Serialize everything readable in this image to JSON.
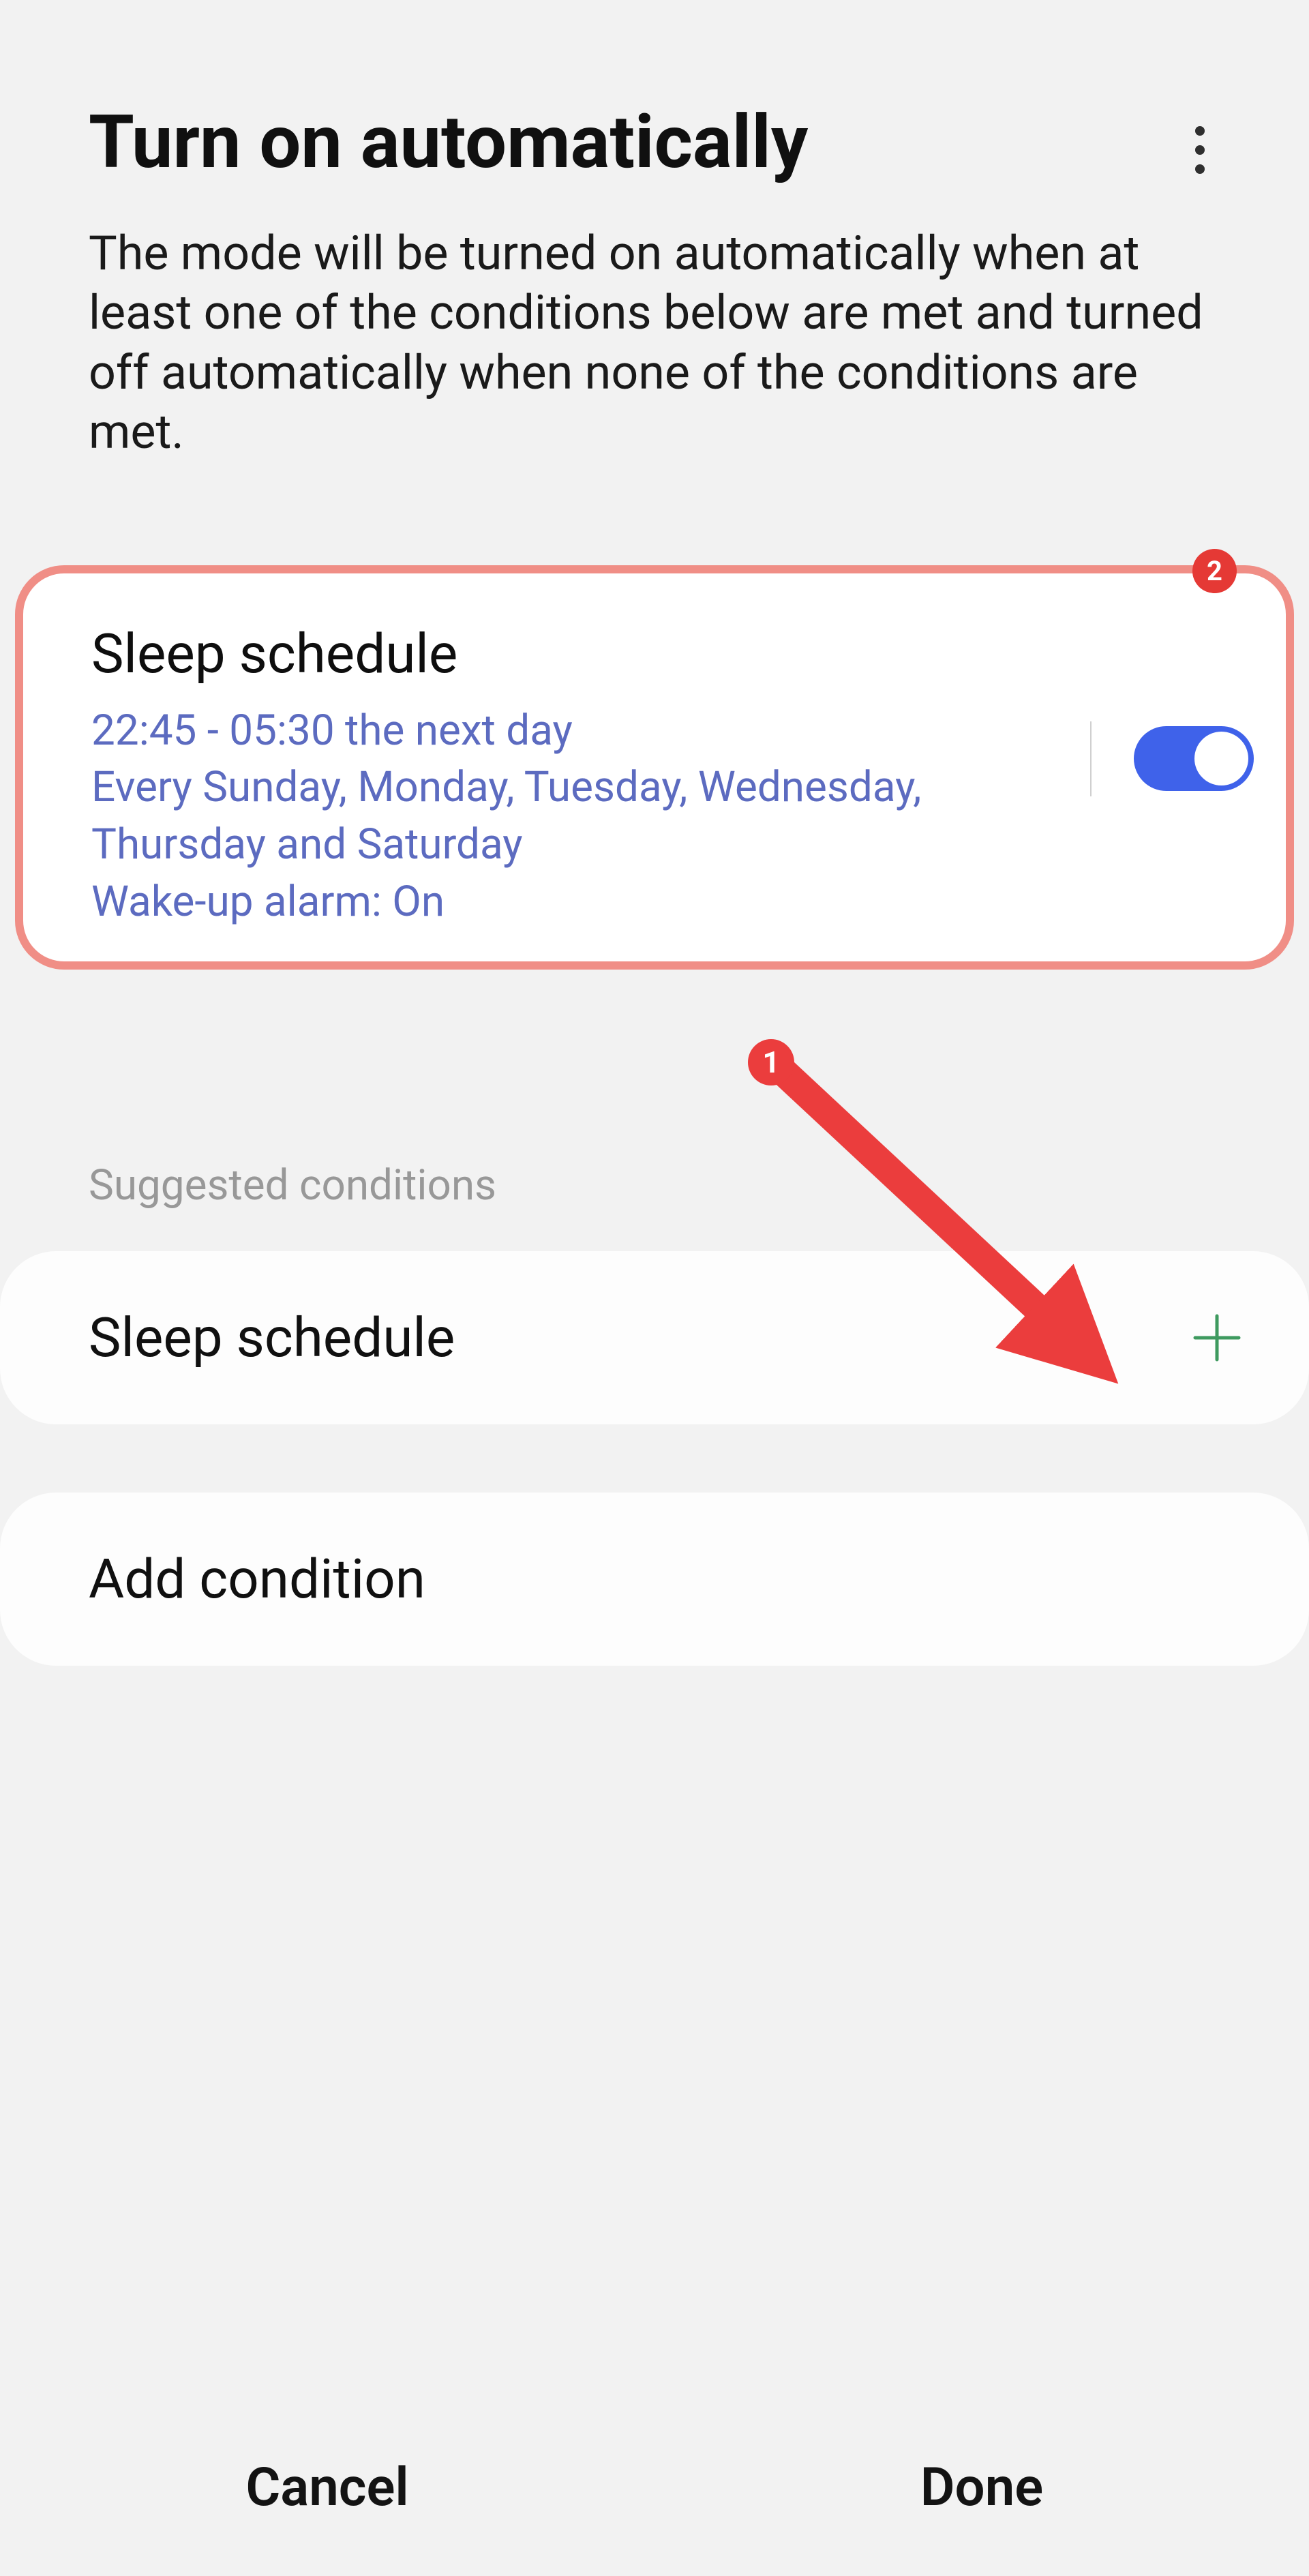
{
  "header": {
    "title": "Turn on automatically"
  },
  "description": "The mode will be turned on automatically when at least one of the conditions below are met and turned off automatically when none of the conditions are met.",
  "condition_card": {
    "title": "Sleep schedule",
    "line1": "22:45 - 05:30 the next day",
    "line2": "Every Sunday, Monday, Tuesday, Wednesday, Thursday and Saturday",
    "line3": "Wake-up alarm: On",
    "toggle": true
  },
  "annotations": {
    "badge_card": "2",
    "badge_arrow": "1"
  },
  "section_label": "Suggested conditions",
  "suggested": {
    "label": "Sleep schedule"
  },
  "add_condition_label": "Add condition",
  "footer": {
    "cancel": "Cancel",
    "done": "Done"
  }
}
